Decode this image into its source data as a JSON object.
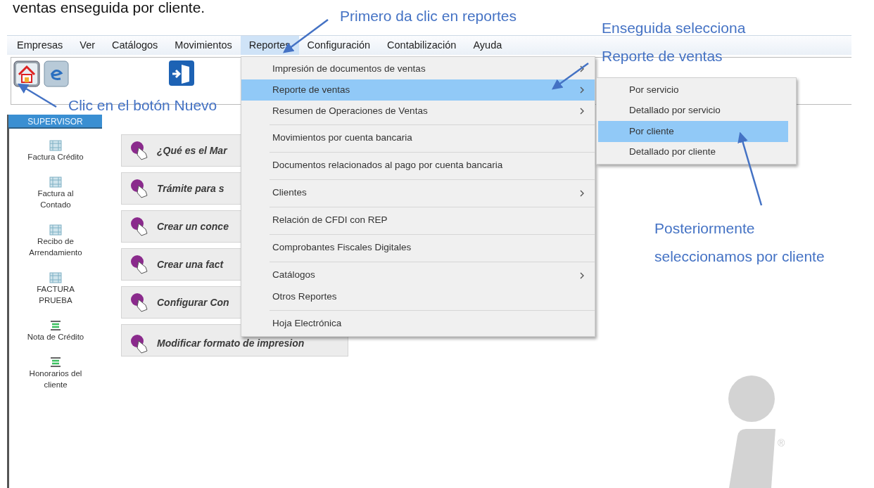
{
  "document_text": "ventas enseguida por cliente.",
  "menu_bar": [
    {
      "label": "Empresas",
      "selected": false
    },
    {
      "label": "Ver",
      "selected": false
    },
    {
      "label": "Catálogos",
      "selected": false
    },
    {
      "label": "Movimientos",
      "selected": false
    },
    {
      "label": "Reportes",
      "selected": true
    },
    {
      "label": "Configuración",
      "selected": false
    },
    {
      "label": "Contabilización",
      "selected": false
    },
    {
      "label": "Ayuda",
      "selected": false
    }
  ],
  "sidebar": {
    "header": "SUPERVISOR",
    "items": [
      {
        "label": "Factura Crédito",
        "kind": "grid"
      },
      {
        "label": "Factura al Contado",
        "kind": "grid"
      },
      {
        "label": "Recibo de Arrendamiento",
        "kind": "grid"
      },
      {
        "label": "FACTURA PRUEBA",
        "kind": "grid"
      },
      {
        "label": "Nota de Crédito",
        "kind": "lines"
      },
      {
        "label": "Honorarios del cliente",
        "kind": "lines"
      }
    ]
  },
  "help_buttons": [
    {
      "label": "¿Qué es el Mar"
    },
    {
      "label": "Trámite para s"
    },
    {
      "label": "Crear un conce"
    },
    {
      "label": "Crear una fact"
    },
    {
      "label": "Configurar Con"
    },
    {
      "label": "Modificar formato de impresion"
    }
  ],
  "reportes_menu": [
    {
      "label": "Impresión de documentos de ventas",
      "submenu": true,
      "selected": false,
      "divider": false
    },
    {
      "label": "Reporte de ventas",
      "submenu": true,
      "selected": true,
      "divider": false
    },
    {
      "label": "Resumen de Operaciones de Ventas",
      "submenu": true,
      "selected": false,
      "divider": false
    },
    {
      "label": "Movimientos por cuenta bancaria",
      "submenu": false,
      "selected": false,
      "divider": true
    },
    {
      "label": "Documentos relacionados al pago por cuenta bancaria",
      "submenu": false,
      "selected": false,
      "divider": true
    },
    {
      "label": "Clientes",
      "submenu": true,
      "selected": false,
      "divider": true
    },
    {
      "label": "Relación de CFDI con REP",
      "submenu": false,
      "selected": false,
      "divider": true
    },
    {
      "label": "Comprobantes Fiscales Digitales",
      "submenu": false,
      "selected": false,
      "divider": true
    },
    {
      "label": "Catálogos",
      "submenu": true,
      "selected": false,
      "divider": true
    },
    {
      "label": "Otros Reportes",
      "submenu": false,
      "selected": false,
      "divider": false
    },
    {
      "label": "Hoja Electrónica",
      "submenu": false,
      "selected": false,
      "divider": true
    }
  ],
  "ventas_submenu": [
    {
      "label": "Por servicio",
      "selected": false
    },
    {
      "label": "Detallado por servicio",
      "selected": false
    },
    {
      "label": "Por cliente",
      "selected": true
    },
    {
      "label": "Detallado por cliente",
      "selected": false
    }
  ],
  "annotations": [
    {
      "lines": [
        "Primero da clic en reportes"
      ]
    },
    {
      "lines": [
        "Clic en el botón Nuevo"
      ]
    },
    {
      "lines": [
        "Enseguida selecciona",
        "Reporte de ventas"
      ]
    },
    {
      "lines": [
        "Posteriormente",
        "seleccionamos por cliente"
      ]
    }
  ],
  "logo": {
    "mark": "®"
  }
}
